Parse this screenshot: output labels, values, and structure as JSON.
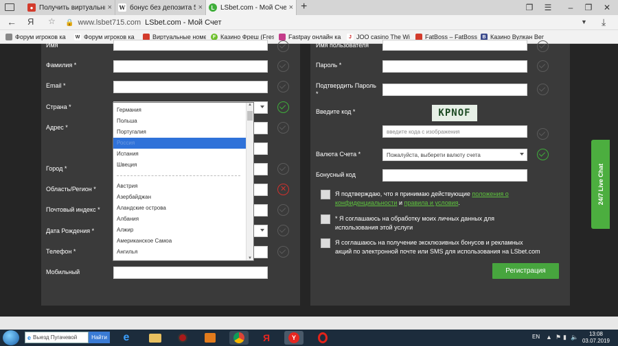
{
  "browser": {
    "tabs": [
      {
        "title": "Получить виртуальный но",
        "icon_color": "#d33b2c"
      },
      {
        "title": "бонус без депозита 5 евро",
        "icon": "W",
        "icon_color": "#555555"
      },
      {
        "title": "LSbet.com - Мой Счет",
        "icon_color": "#3fae3a"
      }
    ],
    "new_tab": "+",
    "url_domain": "www.lsbet715.com",
    "url_page_title": "LSbet.com - Мой Счет",
    "bookmarks": [
      "Форум игроков ка",
      "Форум игроков ка",
      "Виртуальные номе",
      "Казино Фреш (Fres",
      "Fastpay онлайн ка",
      "JOO casino The Wi",
      "FatBoss – FatBoss",
      "Казино Вулкан Вег"
    ]
  },
  "form_left": {
    "labels": {
      "firstname": "Имя",
      "lastname": "Фамилия *",
      "email": "Email *",
      "country": "Страна *",
      "address": "Адрес *",
      "city": "Город *",
      "region": "Область/Регион *",
      "postal": "Почтовый индекс *",
      "birth": "Дата Рождения *",
      "phone": "Телефон *",
      "mobile": "Мобильный"
    }
  },
  "country_dropdown": {
    "items": [
      "Германия",
      "Польша",
      "Португалия",
      "Россия",
      "Испания",
      "Швеция",
      "Австрия",
      "Азербайджан",
      "Аландские острова",
      "Албания",
      "Алжир",
      "Американское Самоа",
      "Ангилья"
    ],
    "selected": "Россия"
  },
  "form_right": {
    "labels": {
      "username": "Имя пользователя",
      "password": "Пароль *",
      "confirm_password": "Подтвердить Пароль *",
      "captcha_label": "Введите код *",
      "currency": "Валюта Счета *",
      "bonus_code": "Бонусный код"
    },
    "captcha_text": "KPNOF",
    "captcha_placeholder": "введите кода с изображения",
    "currency_placeholder": "Пожалуйста, выберети валюту счета",
    "consents": {
      "c1_before": "Я подтверждаю, что я принимаю действующие ",
      "c1_link1": "положения о конфиденциальности",
      "c1_and": " и ",
      "c1_link2": "правила и условия",
      "c1_after": ".",
      "c2": "* Я соглашаюсь на обработку моих личных данных для использования этой услуги",
      "c3": "Я соглашаюсь на получение эксклюзивных бонусов и рекламных акций по электронной почте или SMS для использования на LSbet.com"
    },
    "register_button": "Регистрация"
  },
  "live_chat": "24/7 Live Chat",
  "taskbar": {
    "search_text": "Выезд Пугачевой",
    "search_button": "Найти",
    "language": "EN",
    "time": "13:08",
    "date": "03.07.2019"
  },
  "colors": {
    "accent_green": "#47a53e",
    "error_red": "#d0312d",
    "panel_bg": "#3a3a3a",
    "page_bg": "#252525"
  }
}
